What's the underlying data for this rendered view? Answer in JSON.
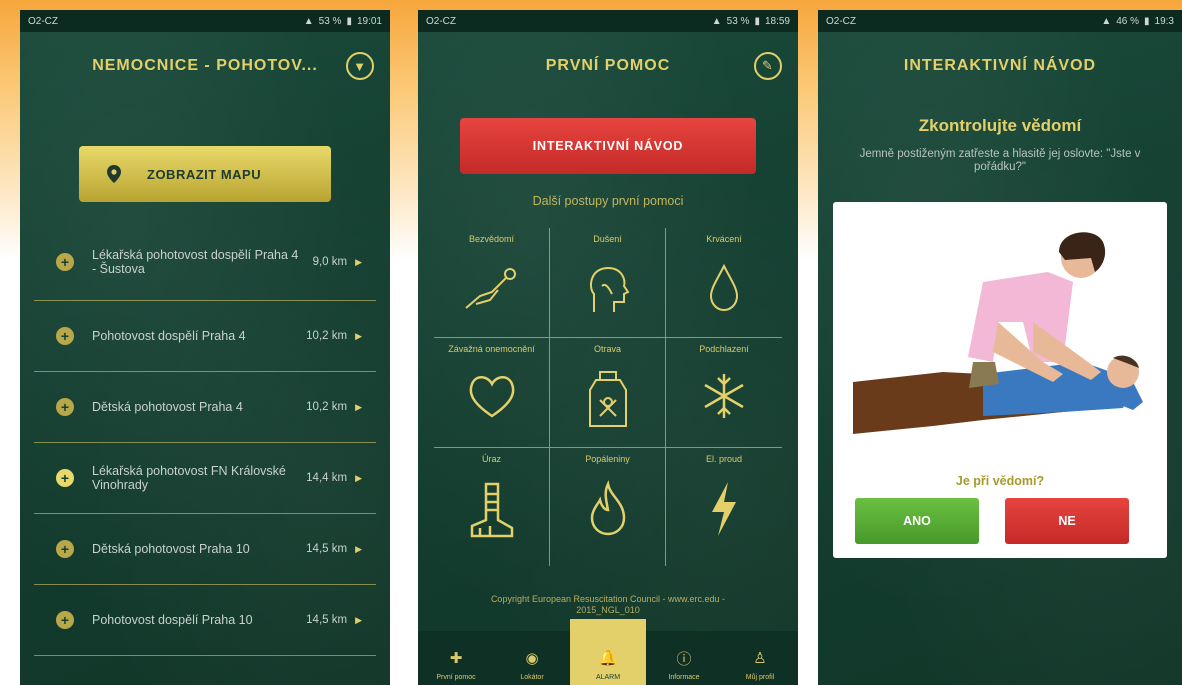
{
  "panel1": {
    "status": {
      "carrier": "O2-CZ",
      "right": "53 %",
      "time": "19:01"
    },
    "title": "NEMOCNICE - POHOTOV...",
    "filter_icon": "filter-icon",
    "map_button": "ZOBRAZIT MAPU",
    "hospitals": [
      {
        "name": "Lékařská pohotovost dospělí Praha 4 - Šustova",
        "distance": "9,0 km"
      },
      {
        "name": "Pohotovost dospělí Praha 4",
        "distance": "10,2 km"
      },
      {
        "name": "Dětská pohotovost Praha 4",
        "distance": "10,2 km"
      },
      {
        "name": "Lékařská pohotovost FN Královské Vinohrady",
        "distance": "14,4 km"
      },
      {
        "name": "Dětská pohotovost Praha 10",
        "distance": "14,5 km"
      },
      {
        "name": "Pohotovost dospělí Praha 10",
        "distance": "14,5 km"
      }
    ]
  },
  "panel2": {
    "status": {
      "carrier": "O2-CZ",
      "right": "53 %",
      "time": "18:59"
    },
    "title": "PRVNÍ POMOC",
    "interactive_button": "INTERAKTIVNÍ NÁVOD",
    "subtitle": "Další postupy první pomoci",
    "cells": [
      {
        "label": "Bezvědomí",
        "icon": "unconscious-icon"
      },
      {
        "label": "Dušení",
        "icon": "choking-icon"
      },
      {
        "label": "Krvácení",
        "icon": "bleeding-icon"
      },
      {
        "label": "Závažná onemocnění",
        "icon": "heart-icon"
      },
      {
        "label": "Otrava",
        "icon": "poison-icon"
      },
      {
        "label": "Podchlazení",
        "icon": "snowflake-icon"
      },
      {
        "label": "Úraz",
        "icon": "injury-icon"
      },
      {
        "label": "Popáleniny",
        "icon": "fire-icon"
      },
      {
        "label": "El. proud",
        "icon": "lightning-icon"
      }
    ],
    "copyright": "Copyright European Resuscitation Council - www.erc.edu - 2015_NGL_010",
    "tabs": [
      {
        "label": "První pomoc",
        "icon": "first-aid-icon"
      },
      {
        "label": "Lokátor",
        "icon": "locator-icon"
      },
      {
        "label": "ALARM",
        "icon": "alarm-bell-icon"
      },
      {
        "label": "Informace",
        "icon": "info-icon"
      },
      {
        "label": "Můj profil",
        "icon": "profile-icon"
      }
    ]
  },
  "panel3": {
    "status": {
      "carrier": "O2-CZ",
      "right": "46 %",
      "time": "19:3"
    },
    "title": "INTERAKTIVNÍ NÁVOD",
    "heading": "Zkontrolujte vědomí",
    "instruction": "Jemně postiženým zatřeste a hlasitě jej oslovte: \"Jste v pořádku?\"",
    "question": "Je při vědomí?",
    "yes": "ANO",
    "no": "NE"
  }
}
